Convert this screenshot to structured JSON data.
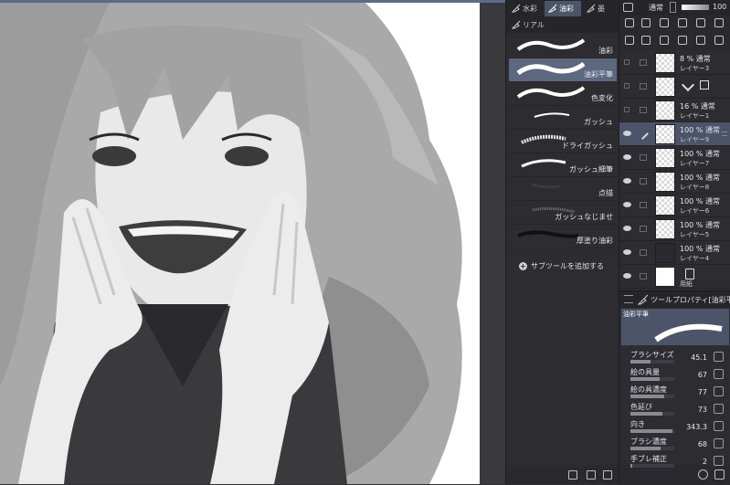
{
  "subtool": {
    "tabs": [
      {
        "label": "水彩",
        "icon": "brush-icon"
      },
      {
        "label": "油彩",
        "icon": "brush-icon"
      },
      {
        "label": "墨",
        "icon": "brush-icon"
      },
      {
        "label": "リアル",
        "icon": "brush-icon"
      }
    ],
    "brushes": [
      {
        "label": "油彩"
      },
      {
        "label": "油彩平筆"
      },
      {
        "label": "色変化"
      },
      {
        "label": "ガッシュ"
      },
      {
        "label": "ドライガッシュ"
      },
      {
        "label": "ガッシュ細筆"
      },
      {
        "label": "点描"
      },
      {
        "label": "ガッシュなじませ"
      },
      {
        "label": "厚塗り油彩"
      }
    ],
    "add_label": "サブツールを追加する"
  },
  "layers_header": {
    "blend_mode": "通常",
    "opacity": "100"
  },
  "layers": [
    {
      "pct": "8 %",
      "mode": "通常",
      "name": "レイヤー3",
      "visible": false,
      "thumb": "checker"
    },
    {
      "pct": "",
      "mode": "",
      "name": "",
      "visible": false,
      "thumb": "checker"
    },
    {
      "pct": "16 %",
      "mode": "通常",
      "name": "レイヤー1",
      "visible": false,
      "thumb": "checker"
    },
    {
      "pct": "100 %",
      "mode": "通常",
      "name": "レイヤー9",
      "visible": true,
      "thumb": "checker"
    },
    {
      "pct": "100 %",
      "mode": "通常",
      "name": "レイヤー7",
      "visible": true,
      "thumb": "checker"
    },
    {
      "pct": "100 %",
      "mode": "通常",
      "name": "レイヤー8",
      "visible": true,
      "thumb": "checker"
    },
    {
      "pct": "100 %",
      "mode": "通常",
      "name": "レイヤー6",
      "visible": true,
      "thumb": "checker"
    },
    {
      "pct": "100 %",
      "mode": "通常",
      "name": "レイヤー5",
      "visible": true,
      "thumb": "checker"
    },
    {
      "pct": "100 %",
      "mode": "通常",
      "name": "レイヤー4",
      "visible": true,
      "thumb": "dark"
    },
    {
      "pct": "",
      "mode": "",
      "name": "用紙",
      "visible": true,
      "thumb": "white"
    }
  ],
  "tool_property": {
    "title": "ツールプロパティ[油彩平",
    "preview_label": "油彩平筆",
    "rows": [
      {
        "label": "ブラシサイズ",
        "value": "45.1",
        "fill": 0.45
      },
      {
        "label": "絵の具量",
        "value": "67",
        "fill": 0.67
      },
      {
        "label": "絵の具濃度",
        "value": "77",
        "fill": 0.77
      },
      {
        "label": "色延び",
        "value": "73",
        "fill": 0.73
      },
      {
        "label": "向き",
        "value": "343.3",
        "fill": 0.95
      },
      {
        "label": "ブラシ濃度",
        "value": "68",
        "fill": 0.68
      },
      {
        "label": "手ブレ補正",
        "value": "2",
        "fill": 0.02
      }
    ]
  }
}
